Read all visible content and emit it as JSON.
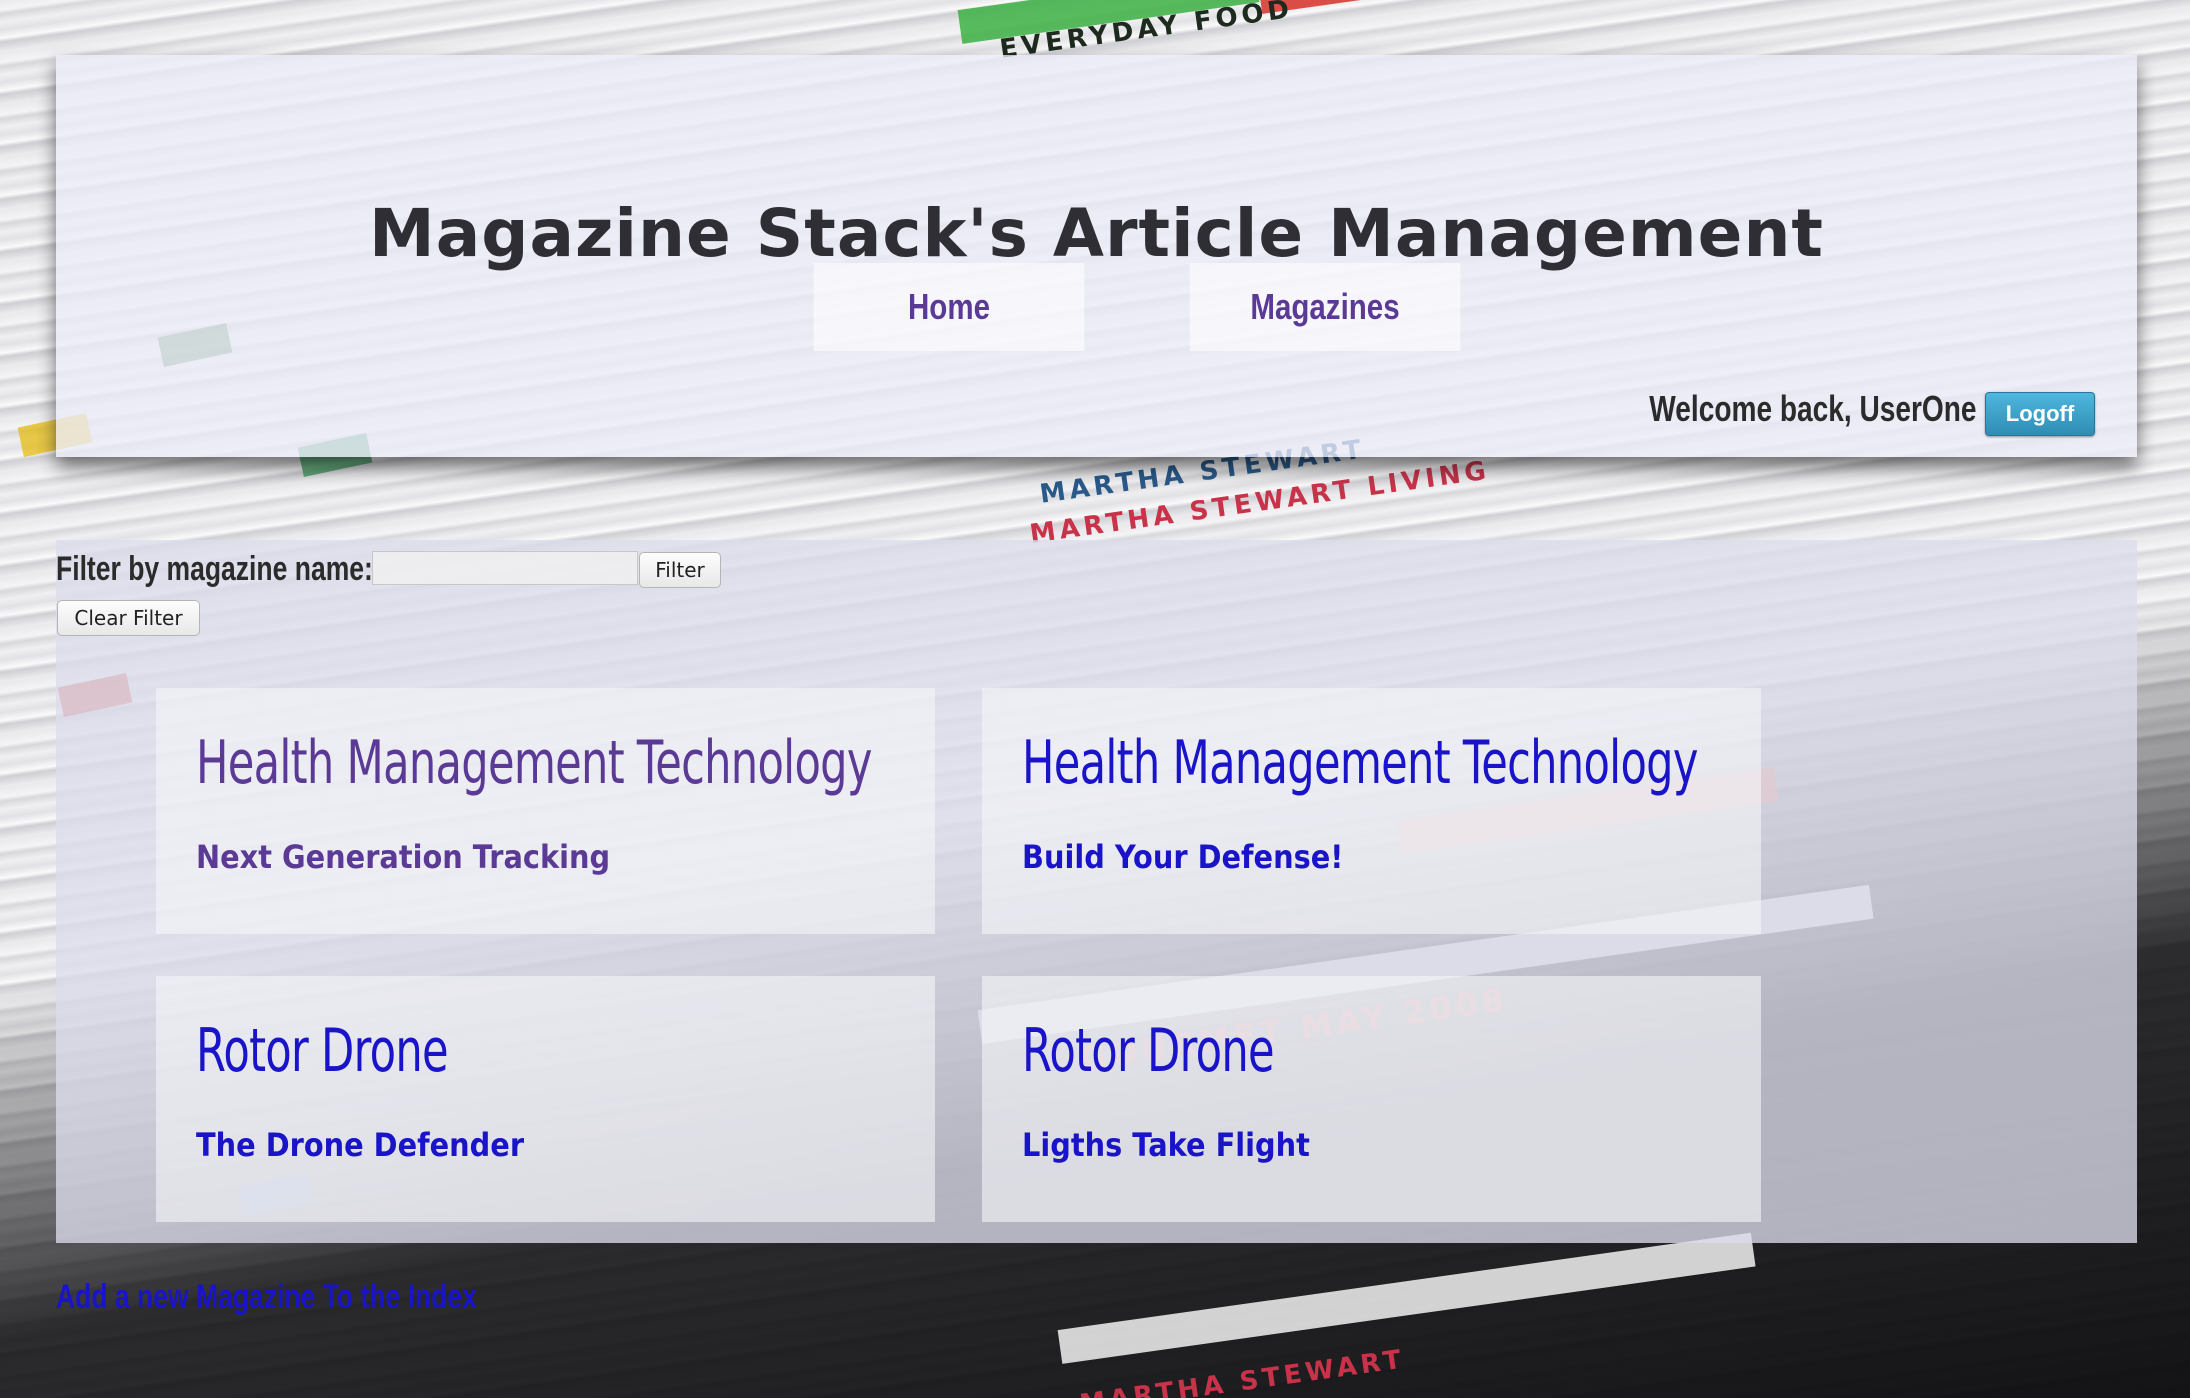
{
  "header": {
    "title": "Magazine Stack's Article Management",
    "nav": [
      {
        "label": "Home"
      },
      {
        "label": "Magazines"
      }
    ],
    "welcome_text": "Welcome back, UserOne",
    "logoff_label": "Logoff"
  },
  "filter": {
    "label": "Filter by magazine name:",
    "input_value": "",
    "filter_button": "Filter",
    "clear_button": "Clear Filter"
  },
  "articles": [
    {
      "magazine": "Health Management Technology",
      "title": "Next Generation Tracking",
      "state": "visited"
    },
    {
      "magazine": "Health Management Technology",
      "title": "Build Your Defense!",
      "state": "unvisited"
    },
    {
      "magazine": "Rotor Drone",
      "title": "The Drone Defender",
      "state": "unvisited"
    },
    {
      "magazine": "Rotor Drone",
      "title": "Ligths Take Flight",
      "state": "unvisited"
    }
  ],
  "footer": {
    "add_link": "Add a new Magazine To the Index"
  },
  "colors": {
    "visited_link": "#5b3a96",
    "link": "#1a14c8",
    "logoff_button": "#3aa3cc"
  }
}
